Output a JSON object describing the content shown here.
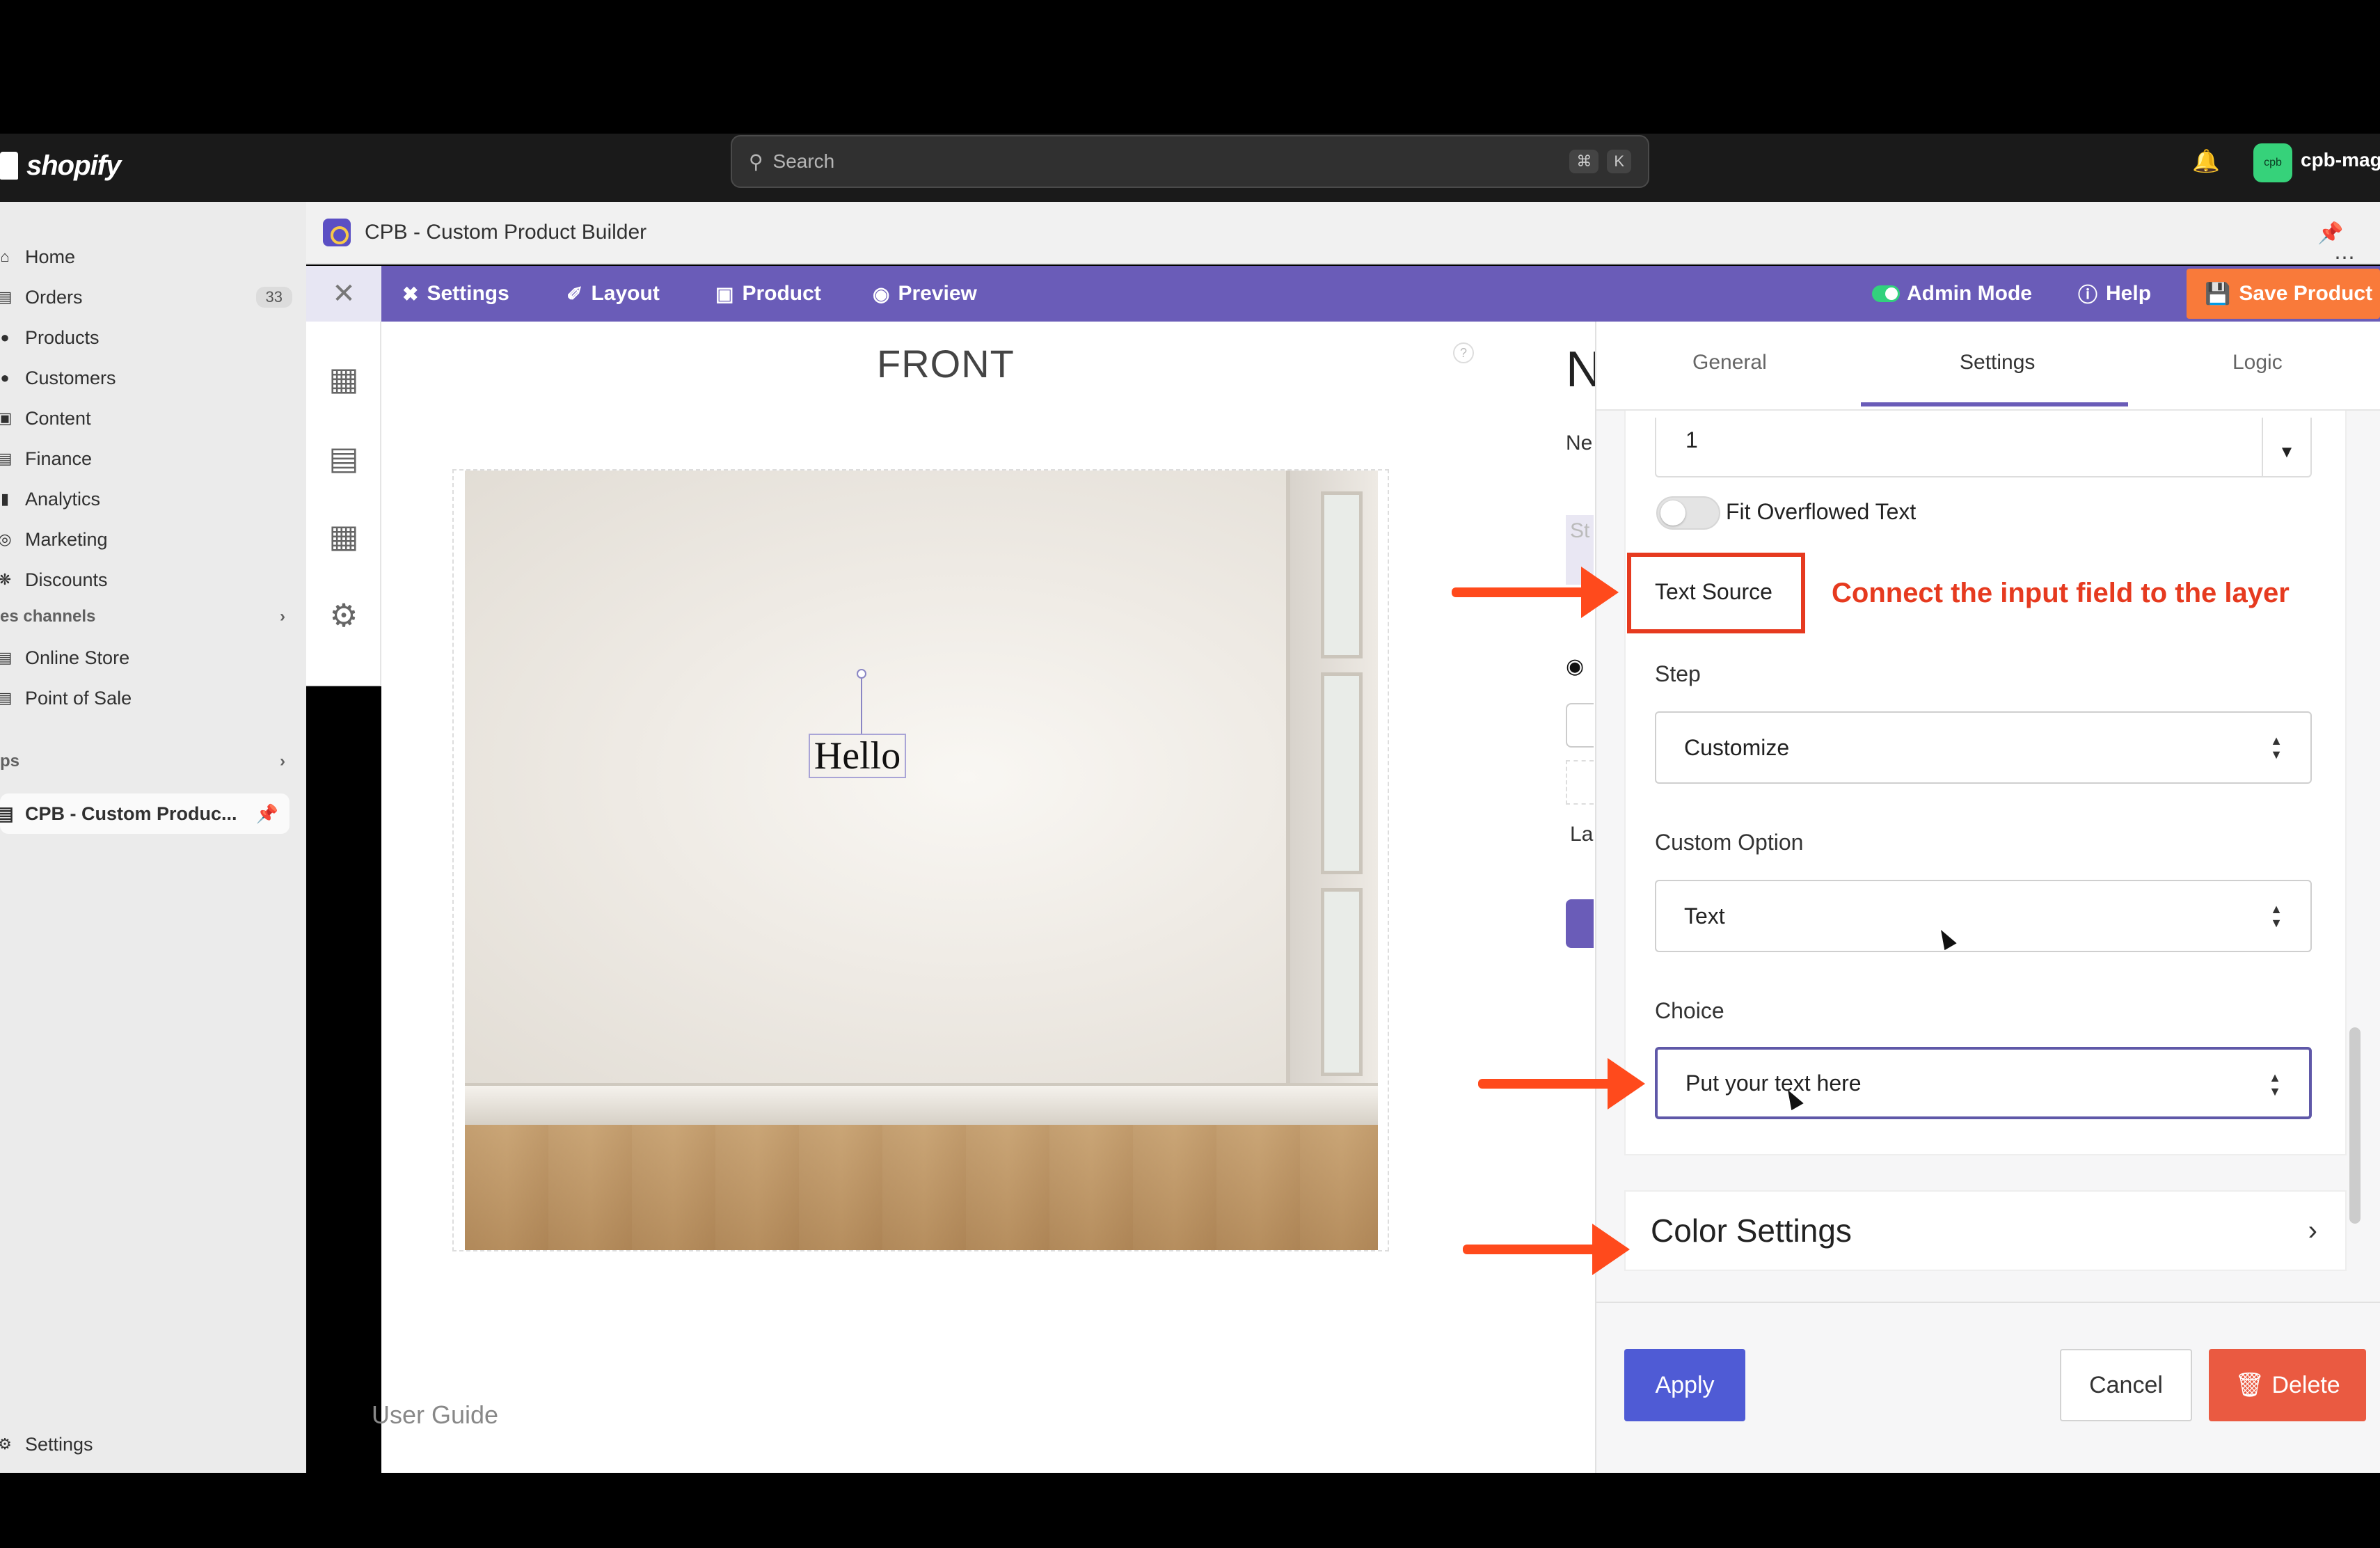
{
  "topbar": {
    "brand": "shopify",
    "search_placeholder": "Search",
    "shortcut_keys": [
      "⌘",
      "K"
    ],
    "store_name": "cpb-mago",
    "avatar_text": "cpb"
  },
  "sidebar": {
    "items": [
      {
        "label": "Home",
        "icon": "home-icon"
      },
      {
        "label": "Orders",
        "icon": "orders-icon",
        "count": "33"
      },
      {
        "label": "Products",
        "icon": "tag-icon"
      },
      {
        "label": "Customers",
        "icon": "person-icon"
      },
      {
        "label": "Content",
        "icon": "image-icon"
      },
      {
        "label": "Finance",
        "icon": "bank-icon"
      },
      {
        "label": "Analytics",
        "icon": "bar-chart-icon"
      },
      {
        "label": "Marketing",
        "icon": "target-icon"
      },
      {
        "label": "Discounts",
        "icon": "discount-icon"
      }
    ],
    "sales_channels_label": "es channels",
    "channels": [
      {
        "label": "Online Store",
        "icon": "store-icon"
      },
      {
        "label": "Point of Sale",
        "icon": "pos-icon"
      }
    ],
    "apps_label": "ps",
    "app_item": "CPB - Custom Produc...",
    "settings_label": "Settings"
  },
  "app": {
    "title": "CPB - Custom Product Builder",
    "toolbar": {
      "settings": "Settings",
      "layout": "Layout",
      "product": "Product",
      "preview": "Preview",
      "admin_mode": "Admin Mode",
      "help": "Help",
      "save": "Save Product"
    }
  },
  "canvas": {
    "side_label": "FRONT",
    "layer_text": "Hello",
    "user_guide": "User Guide",
    "help_mark": "?"
  },
  "peek": {
    "heading_fragment": "N",
    "label_fragment": "Ne",
    "box_fragment": "St",
    "la_fragment": "La"
  },
  "panel": {
    "tabs": [
      "General",
      "Settings",
      "Logic"
    ],
    "active_tab": "Settings",
    "number_value": "1",
    "fit_overflow_label": "Fit Overflowed Text",
    "text_source_label": "Text Source",
    "annotation": "Connect the input field to the layer",
    "step_label": "Step",
    "step_value": "Customize",
    "custom_option_label": "Custom Option",
    "custom_option_value": "Text",
    "choice_label": "Choice",
    "choice_value": "Put your text here",
    "color_settings": "Color Settings",
    "apply": "Apply",
    "cancel": "Cancel",
    "delete": "Delete"
  },
  "colors": {
    "accent_purple": "#6a5cb8",
    "save_orange": "#f97a3a",
    "apply_blue": "#4f5bd5",
    "delete_red": "#ea5a41",
    "annotation_red": "#e63a1f"
  }
}
